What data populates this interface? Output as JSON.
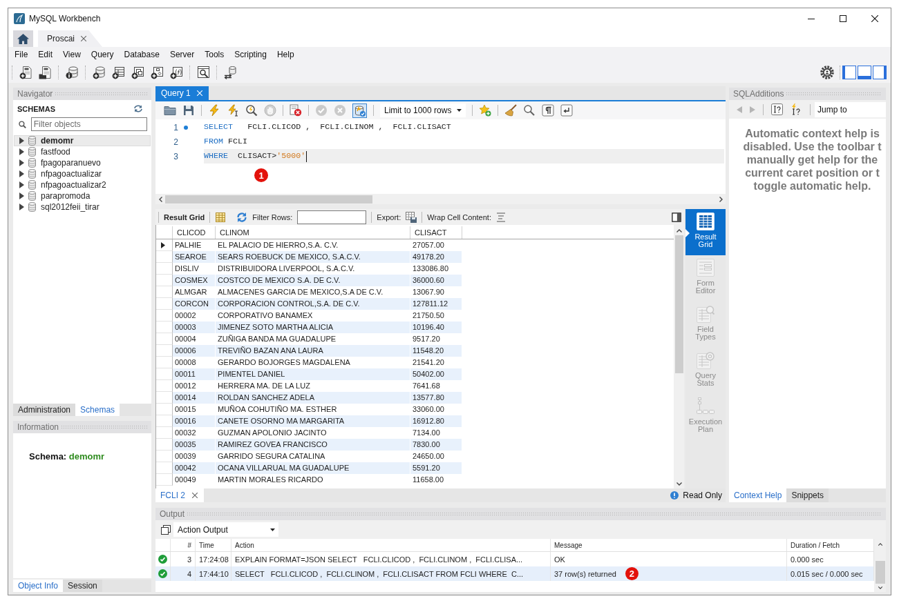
{
  "window": {
    "title": "MySQL Workbench"
  },
  "connection_tabs": [
    {
      "kind": "home",
      "selected": false
    },
    {
      "kind": "connection",
      "label": "Proscai",
      "selected": true
    }
  ],
  "menu": [
    "File",
    "Edit",
    "View",
    "Query",
    "Database",
    "Server",
    "Tools",
    "Scripting",
    "Help"
  ],
  "navigator": {
    "title": "Navigator",
    "heading": "SCHEMAS",
    "filter": {
      "placeholder": "Filter objects"
    },
    "schemas": [
      {
        "name": "demomr",
        "selected": true,
        "expanded": false
      },
      {
        "name": "fastfood",
        "selected": false,
        "expanded": false
      },
      {
        "name": "fpagoparanuevo",
        "selected": false,
        "expanded": false
      },
      {
        "name": "nfpagoactualizar",
        "selected": false,
        "expanded": false
      },
      {
        "name": "nfpagoactualizar2",
        "selected": false,
        "expanded": false
      },
      {
        "name": "parapromoda",
        "selected": false,
        "expanded": false
      },
      {
        "name": "sql2012feii_tirar",
        "selected": false,
        "expanded": false
      }
    ],
    "tabs": [
      {
        "label": "Administration",
        "selected": false
      },
      {
        "label": "Schemas",
        "selected": true
      }
    ]
  },
  "information": {
    "title": "Information",
    "label": "Schema:",
    "value": "demomr",
    "tabs": [
      {
        "label": "Object Info",
        "selected": true
      },
      {
        "label": "Session",
        "selected": false
      }
    ]
  },
  "query_tabs": [
    {
      "label": "Query 1",
      "selected": true
    }
  ],
  "editor_toolbar": {
    "auto_commit": true,
    "commit_disabled": true,
    "rollback_disabled": true,
    "limit": "Limit to 1000 rows"
  },
  "editor": {
    "lines": [
      {
        "number": "1",
        "statement_start": true,
        "current": false,
        "tokens": [
          {
            "kind": "keyword",
            "text": "SELECT"
          },
          {
            "kind": "plain",
            "text": "   FCLI.CLICOD ,  FCLI.CLINOM ,  FCLI.CLISACT"
          }
        ]
      },
      {
        "number": "2",
        "statement_start": false,
        "current": false,
        "tokens": [
          {
            "kind": "keyword",
            "text": "FROM"
          },
          {
            "kind": "plain",
            "text": " FCLI"
          }
        ]
      },
      {
        "number": "3",
        "statement_start": false,
        "current": true,
        "tokens": [
          {
            "kind": "keyword",
            "text": "WHERE"
          },
          {
            "kind": "plain",
            "text": "  CLISACT>"
          },
          {
            "kind": "string",
            "text": "'5000'"
          }
        ]
      }
    ],
    "callout": "1"
  },
  "result_toolbar": {
    "view": "Result Grid",
    "filter_label": "Filter Rows:",
    "export_label": "Export:",
    "wrap_label": "Wrap Cell Content:"
  },
  "result_grid": {
    "columns": [
      "CLICOD",
      "CLINOM",
      "CLISACT"
    ],
    "rows": [
      {
        "current": true,
        "cells": [
          "PALHIE",
          "EL PALACIO DE HIERRO,S.A. C.V.",
          "27057.00"
        ]
      },
      {
        "current": false,
        "cells": [
          "SEAROE",
          "SEARS ROEBUCK DE MEXICO, S.A.C.V.",
          "49178.20"
        ]
      },
      {
        "current": false,
        "cells": [
          "DISLIV",
          "DISTRIBUIDORA LIVERPOOL, S.A.C.V.",
          "133086.80"
        ]
      },
      {
        "current": false,
        "cells": [
          "COSMEX",
          "COSTCO DE MEXICO S.A. DE C.V.",
          "36000.60"
        ]
      },
      {
        "current": false,
        "cells": [
          "ALMGAR",
          "ALMACENES GARCIA DE MEXICO,S.A DE C.V.",
          "13067.90"
        ]
      },
      {
        "current": false,
        "cells": [
          "CORCON",
          "CORPORACION CONTROL,S.A. DE C.V.",
          "127811.12"
        ]
      },
      {
        "current": false,
        "cells": [
          "00002",
          "CORPORATIVO BANAMEX",
          "21750.50"
        ]
      },
      {
        "current": false,
        "cells": [
          "00003",
          "JIMENEZ SOTO MARTHA ALICIA",
          "10196.40"
        ]
      },
      {
        "current": false,
        "cells": [
          "00004",
          "ZUÑIGA BANDA MA GUADALUPE",
          "9517.20"
        ]
      },
      {
        "current": false,
        "cells": [
          "00006",
          "TREVIÑO BAZAN ANA LAURA",
          "11548.20"
        ]
      },
      {
        "current": false,
        "cells": [
          "00008",
          "GERARDO BOJORGES MAGDALENA",
          "21541.20"
        ]
      },
      {
        "current": false,
        "cells": [
          "00011",
          "PIMENTEL DANIEL",
          "50402.00"
        ]
      },
      {
        "current": false,
        "cells": [
          "00012",
          "HERRERA MA. DE LA LUZ",
          "7641.68"
        ]
      },
      {
        "current": false,
        "cells": [
          "00014",
          "ROLDAN SANCHEZ ADELA",
          "13577.80"
        ]
      },
      {
        "current": false,
        "cells": [
          "00015",
          "MUÑOA COHUTIÑO MA. ESTHER",
          "33060.00"
        ]
      },
      {
        "current": false,
        "cells": [
          "00016",
          "CANETE OSORNO MA MARGARITA",
          "16912.80"
        ]
      },
      {
        "current": false,
        "cells": [
          "00032",
          "GUZMAN APOLONIO JACINTO",
          "7134.00"
        ]
      },
      {
        "current": false,
        "cells": [
          "00035",
          "RAMIREZ GOVEA FRANCISCO",
          "7830.00"
        ]
      },
      {
        "current": false,
        "cells": [
          "00039",
          "GARRIDO SEGURA CATALINA",
          "24650.00"
        ]
      },
      {
        "current": false,
        "cells": [
          "00042",
          "OCANA VILLARUAL MA GUADALUPE",
          "5591.20"
        ]
      },
      {
        "current": false,
        "cells": [
          "00049",
          "MARTIN MORALES RICARDO",
          "11658.00"
        ]
      }
    ]
  },
  "result_views": [
    {
      "kind": "grid",
      "label": "Result Grid",
      "selected": true
    },
    {
      "kind": "form",
      "label": "Form Editor",
      "selected": false
    },
    {
      "kind": "types",
      "label": "Field Types",
      "selected": false
    },
    {
      "kind": "stats",
      "label": "Query Stats",
      "selected": false
    },
    {
      "kind": "plan",
      "label": "Execution Plan",
      "selected": false
    }
  ],
  "result_tabs": [
    {
      "label": "FCLI 2",
      "selected": true
    }
  ],
  "result_status": "Read Only",
  "sql_additions": {
    "title": "SQLAdditions",
    "jump_to": "Jump to",
    "help_lines": [
      "Automatic context help is",
      "disabled. Use the toolbar t",
      "manually get help for the",
      "current caret position or t",
      "toggle automatic help."
    ],
    "tabs": [
      {
        "label": "Context Help",
        "selected": true
      },
      {
        "label": "Snippets",
        "selected": false
      }
    ]
  },
  "output": {
    "title": "Output",
    "view": "Action Output",
    "columns": [
      "#",
      "Time",
      "Action",
      "Message",
      "Duration / Fetch"
    ],
    "rows": [
      {
        "kind": "success",
        "selected": false,
        "number": "3",
        "time": "17:24:08",
        "action": "EXPLAIN FORMAT=JSON SELECT   FCLI.CLICOD ,  FCLI.CLINOM ,  FCLI.CLISA...",
        "message": "OK",
        "duration": "0.000 sec"
      },
      {
        "kind": "success",
        "selected": true,
        "number": "4",
        "time": "17:44:10",
        "action": "SELECT   FCLI.CLICOD ,  FCLI.CLINOM ,  FCLI.CLISACT FROM FCLI WHERE  C...",
        "message": "37 row(s) returned",
        "duration": "0.015 sec / 0.000 sec",
        "callout": "2"
      }
    ]
  }
}
